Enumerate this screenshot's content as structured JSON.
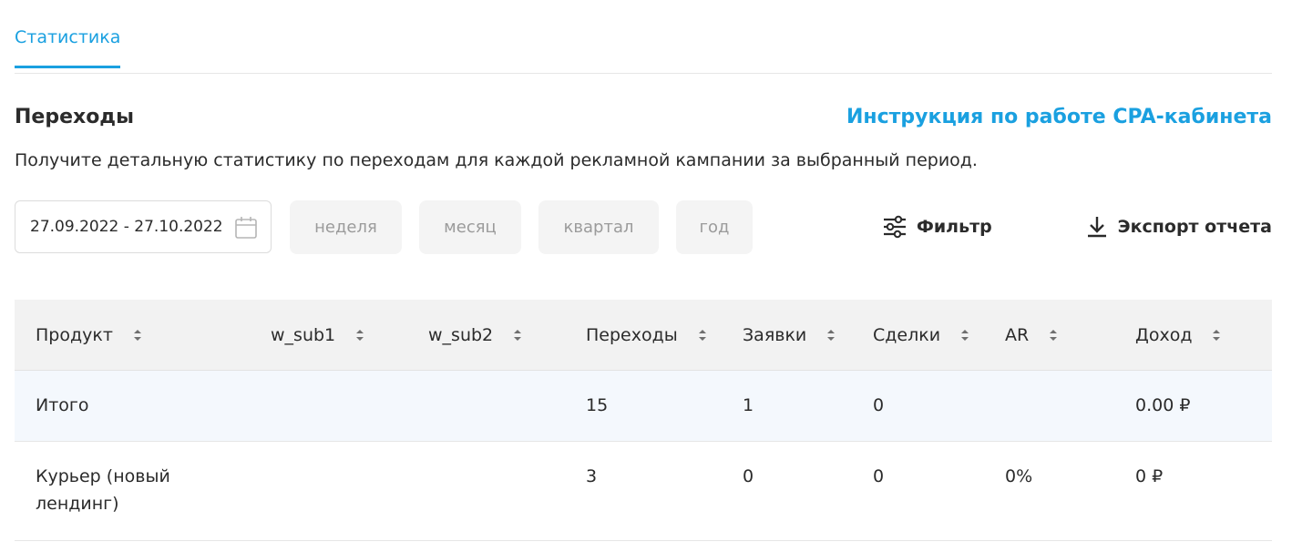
{
  "tabs": {
    "active_label": "Статистика"
  },
  "header": {
    "title": "Переходы",
    "help_link": "Инструкция по работе CPA-кабинета",
    "description": "Получите детальную статистику по переходам для каждой рекламной кампании за выбранный период."
  },
  "controls": {
    "date_range": "27.09.2022 - 27.10.2022",
    "periods": [
      "неделя",
      "месяц",
      "квартал",
      "год"
    ],
    "filter_label": "Фильтр",
    "export_label": "Экспорт отчета"
  },
  "table": {
    "columns": [
      "Продукт",
      "w_sub1",
      "w_sub2",
      "Переходы",
      "Заявки",
      "Сделки",
      "AR",
      "Доход"
    ],
    "total_row": [
      "Итого",
      "",
      "",
      "15",
      "1",
      "0",
      "",
      "0.00 ₽"
    ],
    "rows": [
      [
        "Курьер (новый лендинг)",
        "",
        "",
        "3",
        "0",
        "0",
        "0%",
        "0 ₽"
      ]
    ]
  },
  "colors": {
    "accent": "#1aa0e0",
    "header_bg": "#f2f2f2",
    "total_bg": "#f4f8fd"
  },
  "icons": {
    "date": "calendar-icon",
    "filter": "sliders-icon",
    "export": "download-icon",
    "sort": "sort-icon"
  }
}
